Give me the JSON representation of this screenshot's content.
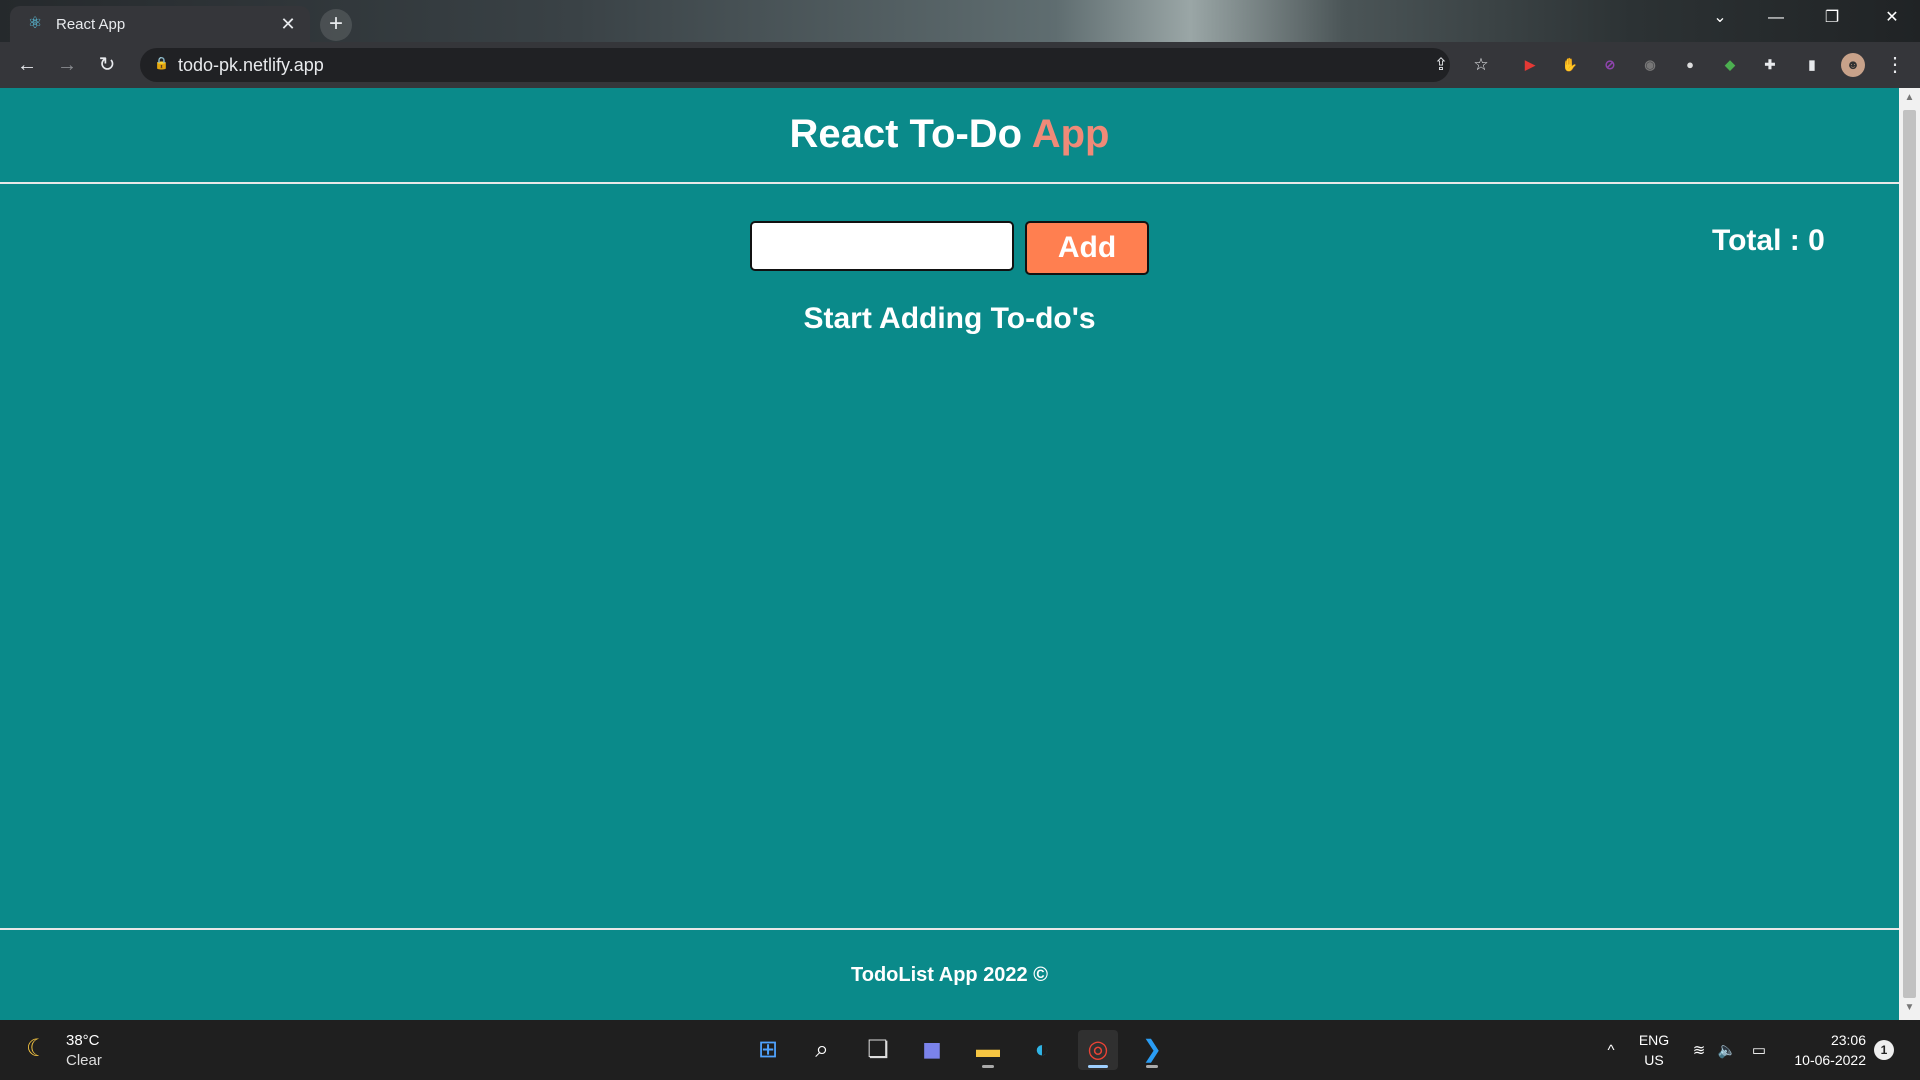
{
  "browser": {
    "tab_title": "React App",
    "tab_close": "✕",
    "new_tab": "+",
    "url": "todo-pk.netlify.app",
    "window_controls": {
      "collapse": "⌄",
      "minimize": "—",
      "restore": "❐",
      "close": "✕"
    },
    "nav": {
      "back": "←",
      "forward": "→",
      "reload": "↻"
    },
    "omnibox_icons": {
      "share": "⇪",
      "bookmark": "☆"
    },
    "extensions": [
      {
        "name": "ext-red-video",
        "glyph": "▶",
        "color": "#e53935"
      },
      {
        "name": "ext-adblock",
        "glyph": "✋",
        "color": "#e53935"
      },
      {
        "name": "ext-block",
        "glyph": "⊘",
        "color": "#8e44ad"
      },
      {
        "name": "ext-camera",
        "glyph": "◉",
        "color": "#777777"
      },
      {
        "name": "ext-circle",
        "glyph": "●",
        "color": "#dddddd"
      },
      {
        "name": "ext-color",
        "glyph": "◆",
        "color": "#4caf50"
      },
      {
        "name": "ext-puzzle",
        "glyph": "✚",
        "color": "#e8eaed"
      },
      {
        "name": "ext-sidepanel",
        "glyph": "▮",
        "color": "#e8eaed"
      }
    ],
    "menu": "⋮"
  },
  "app": {
    "title_main": "React To-Do",
    "title_accent": "App",
    "input_value": "",
    "add_label": "Add",
    "total_label": "Total : 0",
    "empty_message": "Start Adding To-do's",
    "footer": "TodoList App 2022 ©",
    "accent_color": "#f08a78",
    "button_color": "#ff7f50",
    "background_color": "#0a8a8a"
  },
  "taskbar": {
    "weather_temp": "38°C",
    "weather_cond": "Clear",
    "apps": [
      {
        "name": "start",
        "glyph": "⊞",
        "color": "#4fa3ff"
      },
      {
        "name": "search",
        "glyph": "⌕",
        "color": "#ffffff"
      },
      {
        "name": "task-view",
        "glyph": "❏",
        "color": "#dddddd"
      },
      {
        "name": "teams-chat",
        "glyph": "◼",
        "color": "#7b83eb"
      },
      {
        "name": "file-explorer",
        "glyph": "▬",
        "color": "#f5c542"
      },
      {
        "name": "edge",
        "glyph": "◐",
        "color": "#2fb4e6"
      },
      {
        "name": "chrome",
        "glyph": "◎",
        "color": "#ea4335"
      },
      {
        "name": "vscode",
        "glyph": "❯",
        "color": "#2a9df4"
      }
    ],
    "lang_top": "ENG",
    "lang_bottom": "US",
    "time": "23:06",
    "date": "10-06-2022",
    "notification_count": "1",
    "tray": {
      "chevron": "^",
      "wifi": "≋",
      "volume": "🔈",
      "battery": "▭"
    }
  }
}
